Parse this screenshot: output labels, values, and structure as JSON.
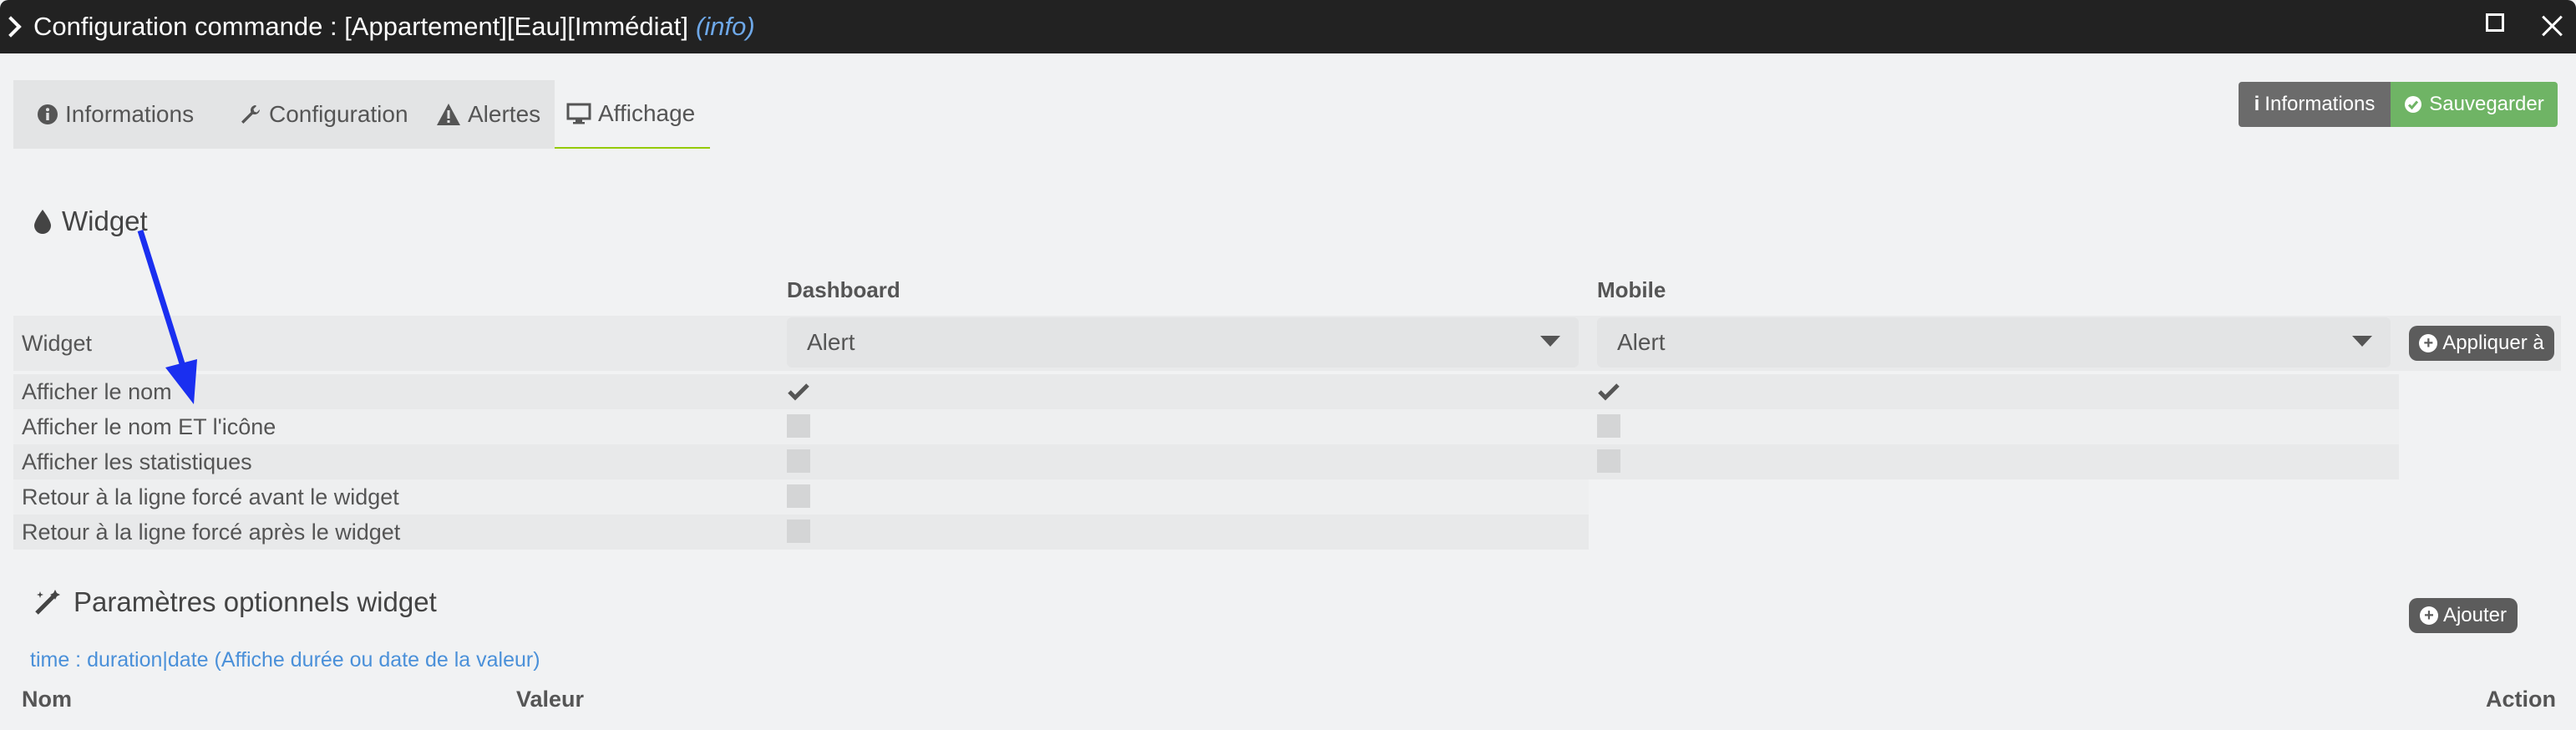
{
  "window": {
    "title": "Configuration commande : [Appartement][Eau][Immédiat]",
    "title_info": "(info)"
  },
  "tabs": [
    {
      "label": "Informations",
      "icon": "info-circle-icon"
    },
    {
      "label": "Configuration",
      "icon": "wrench-icon"
    },
    {
      "label": "Alertes",
      "icon": "warning-icon"
    },
    {
      "label": "Affichage",
      "icon": "monitor-icon",
      "active": true
    }
  ],
  "actions": {
    "info_label": "Informations",
    "save_label": "Sauvegarder"
  },
  "widget_section": {
    "title": "Widget",
    "col_dashboard": "Dashboard",
    "col_mobile": "Mobile",
    "widget_row_label": "Widget",
    "dashboard_widget": "Alert",
    "mobile_widget": "Alert",
    "apply_label": "Appliquer à",
    "rows": [
      {
        "label": "Afficher le nom",
        "dashboard": true,
        "mobile": true
      },
      {
        "label": "Afficher le nom ET l'icône",
        "dashboard": false,
        "mobile": false
      },
      {
        "label": "Afficher les statistiques",
        "dashboard": false,
        "mobile": false
      },
      {
        "label": "Retour à la ligne forcé avant le widget",
        "dashboard": false
      },
      {
        "label": "Retour à la ligne forcé après le widget",
        "dashboard": false
      }
    ]
  },
  "optional_section": {
    "title": "Paramètres optionnels widget",
    "add_label": "Ajouter",
    "help_link": "time : duration|date (Affiche durée ou date de la valeur)",
    "columns": {
      "name": "Nom",
      "value": "Valeur",
      "action": "Action"
    }
  },
  "colors": {
    "titlebar": "#222222",
    "info_accent": "#6ea8e8",
    "save_button": "#6fb465",
    "active_tab_underline": "#94ca02",
    "annotation_arrow": "#1a2ff0"
  }
}
